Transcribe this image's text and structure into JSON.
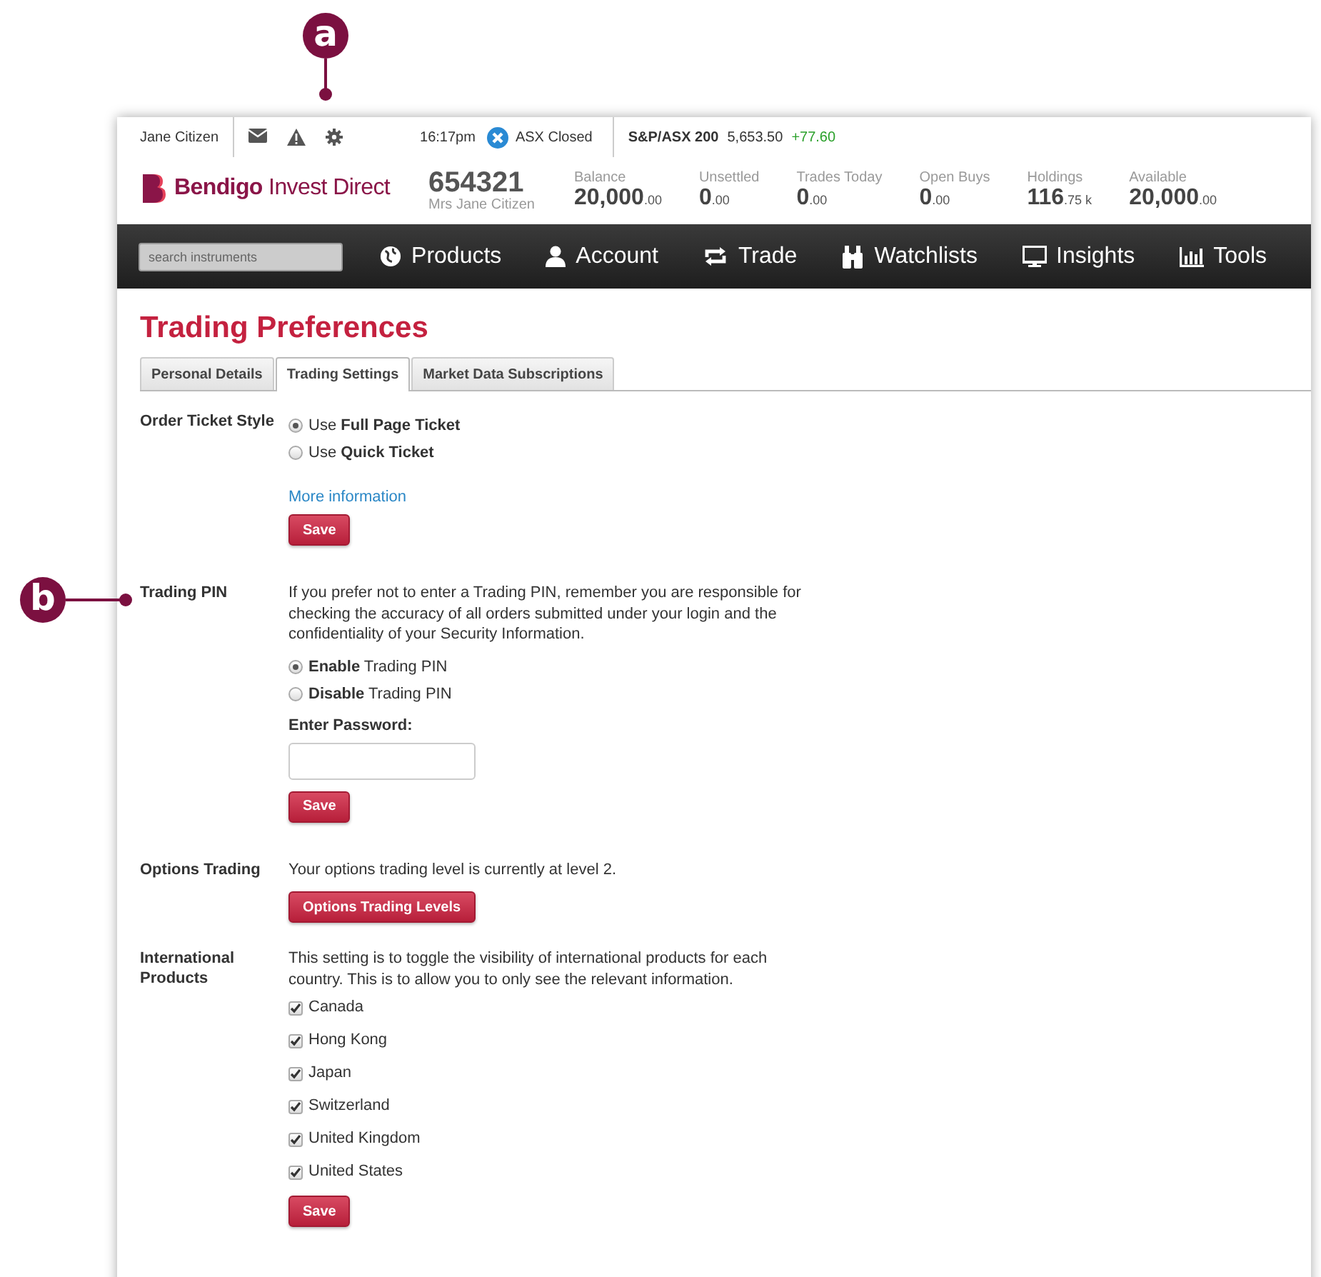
{
  "annotations": [
    {
      "label": "a"
    },
    {
      "label": "b"
    }
  ],
  "top_bar": {
    "user": "Jane Citizen",
    "time": "16:17pm",
    "market_status": "ASX Closed",
    "index": {
      "name": "S&P/ASX 200",
      "value": "5,653.50",
      "change": "+77.60"
    }
  },
  "header": {
    "brand": {
      "name_bold": "Bendigo",
      "name_rest": "Invest Direct"
    },
    "account": {
      "number": "654321",
      "holder": "Mrs Jane Citizen"
    },
    "stats": [
      {
        "label": "Balance",
        "value": "20,000",
        "decimals": ".00"
      },
      {
        "label": "Unsettled",
        "value": "0",
        "decimals": ".00"
      },
      {
        "label": "Trades Today",
        "value": "0",
        "decimals": ".00"
      },
      {
        "label": "Open Buys",
        "value": "0",
        "decimals": ".00"
      },
      {
        "label": "Holdings",
        "value": "116",
        "decimals": ".75 k"
      },
      {
        "label": "Available",
        "value": "20,000",
        "decimals": ".00"
      }
    ]
  },
  "nav": {
    "search_placeholder": "search instruments",
    "items": [
      {
        "label": "Products"
      },
      {
        "label": "Account"
      },
      {
        "label": "Trade"
      },
      {
        "label": "Watchlists"
      },
      {
        "label": "Insights"
      },
      {
        "label": "Tools"
      }
    ]
  },
  "page": {
    "title": "Trading Preferences",
    "tabs": [
      {
        "label": "Personal Details",
        "selected": false
      },
      {
        "label": "Trading Settings",
        "selected": true
      },
      {
        "label": "Market Data Subscriptions",
        "selected": false
      }
    ],
    "sections": [
      {
        "label": "Order Ticket Style",
        "options": [
          {
            "text": "Use **Full Page Ticket**",
            "selected": true
          },
          {
            "text": "Use **Quick Ticket**",
            "selected": false
          }
        ],
        "link": "More information",
        "button": "Save"
      },
      {
        "label": "Trading PIN",
        "description": "If you prefer not to enter a Trading PIN, remember you are responsible for checking the accuracy of all orders submitted under your login and the confidentiality of your Security Information.",
        "options": [
          {
            "text": "**Enable** Trading PIN",
            "selected": true
          },
          {
            "text": "**Disable** Trading PIN",
            "selected": false
          }
        ],
        "password_label": "Enter Password:",
        "button": "Save"
      },
      {
        "label": "Options Trading",
        "description": "Your options trading level is currently at level 2.",
        "button": "Options Trading Levels"
      },
      {
        "label": "International Products",
        "description": "This setting is to toggle the visibility of international products for each country. This is to allow you to only see the relevant information.",
        "countries": [
          {
            "name": "Canada",
            "checked": true
          },
          {
            "name": "Hong Kong",
            "checked": true
          },
          {
            "name": "Japan",
            "checked": true
          },
          {
            "name": "Switzerland",
            "checked": true
          },
          {
            "name": "United Kingdom",
            "checked": true
          },
          {
            "name": "United States",
            "checked": true
          }
        ],
        "button": "Save"
      }
    ]
  }
}
